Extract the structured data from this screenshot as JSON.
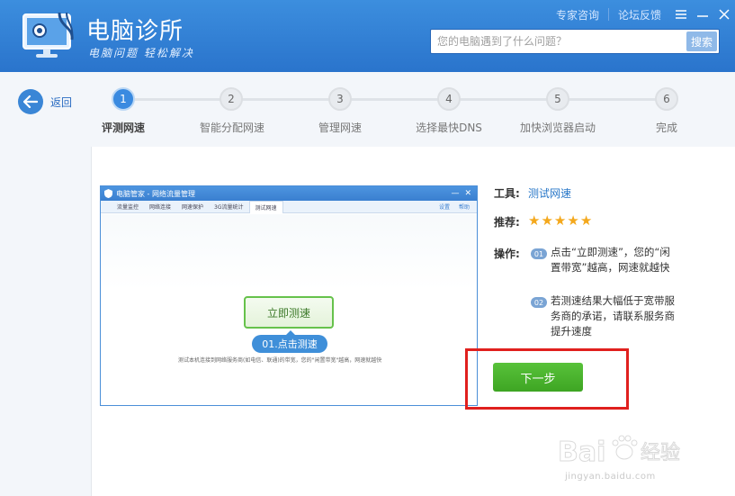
{
  "header": {
    "title": "电脑诊所",
    "slogan": "电脑问题 轻松解决",
    "links": [
      "专家咨询",
      "论坛反馈"
    ],
    "search": {
      "placeholder": "您的电脑遇到了什么问题？",
      "button": "搜索"
    }
  },
  "back": {
    "label": "返回"
  },
  "steps": [
    {
      "num": "1",
      "label": "评测网速",
      "active": true
    },
    {
      "num": "2",
      "label": "智能分配网速",
      "active": false
    },
    {
      "num": "3",
      "label": "管理网速",
      "active": false
    },
    {
      "num": "4",
      "label": "选择最快DNS",
      "active": false
    },
    {
      "num": "5",
      "label": "加快浏览器启动",
      "active": false
    },
    {
      "num": "6",
      "label": "完成",
      "active": false
    }
  ],
  "screenshot": {
    "title": "电脑管家 - 网络流量管理",
    "tabs": [
      "流量监控",
      "网络连接",
      "网速保护",
      "3G流量统计",
      "测试网速"
    ],
    "active_tab": 4,
    "right_links": [
      "设置",
      "帮助"
    ],
    "measure_button": "立即测速",
    "tip": "01.点击测速",
    "description": "测试本机连接到网络服务商(如电信、联通)的带宽，您的\"闲置带宽\"越高，网速就越快"
  },
  "info": {
    "tool_label": "工具:",
    "tool_value": "测试网速",
    "rating_label": "推荐:",
    "rating": 5,
    "ops_label": "操作:",
    "ops": [
      {
        "badge": "01",
        "text": "点击“立即测速”，您的“闲置带宽”越高，网速就越快"
      },
      {
        "badge": "02",
        "text": "若测速结果大幅低于宽带服务商的承诺，请联系服务商提升速度"
      }
    ]
  },
  "next_button": "下一步",
  "watermark": {
    "brand": "Bai度经验",
    "url": "jingyan.baidu.com"
  },
  "colors": {
    "header": "#2a74cc",
    "accent": "#3a8ae0",
    "green": "#3ea523",
    "highlight": "#e0201e",
    "star": "#f4a81c"
  }
}
